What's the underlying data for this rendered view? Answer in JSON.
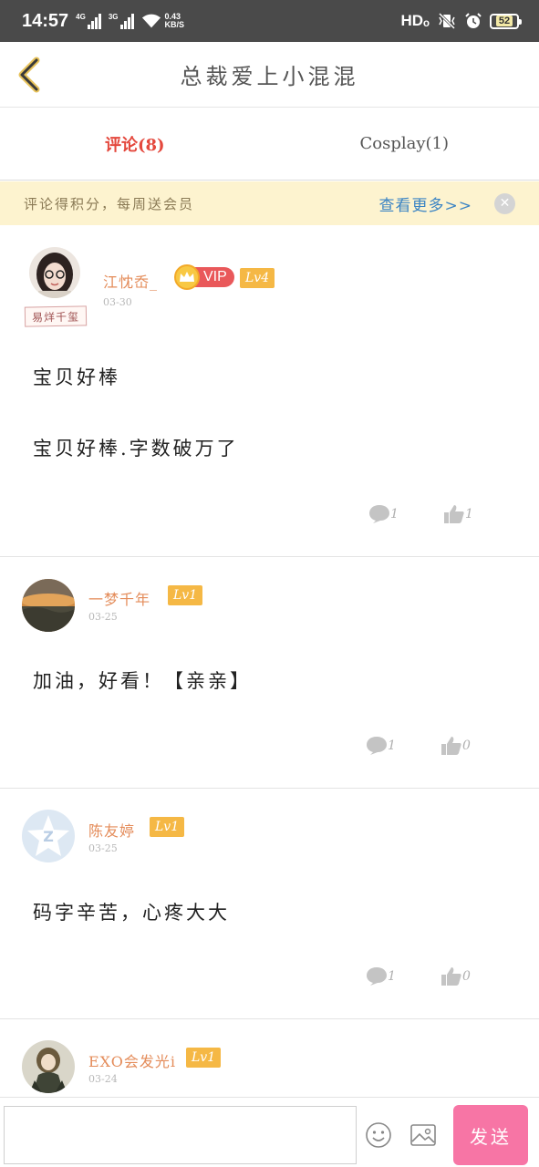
{
  "status_bar": {
    "time": "14:57",
    "net1": "4G",
    "net2": "3G",
    "speed_value": "0.43",
    "speed_unit": "KB/S",
    "hd": "HDₒ",
    "battery": "52"
  },
  "header": {
    "title": "总裁爱上小混混",
    "back_icon": "chevron-left-icon"
  },
  "tabs": [
    {
      "label": "评论(8)",
      "active": true
    },
    {
      "label": "Cosplay(1)",
      "active": false
    }
  ],
  "notice": {
    "message": "评论得积分，每周送会员",
    "more": "查看更多>>",
    "close": "✕"
  },
  "comments": [
    {
      "username": "江忱岙_",
      "vip": "VIP",
      "level": "Lv4",
      "date": "03-30",
      "pendant": "易烊千玺",
      "lines": [
        "宝贝好棒",
        "宝贝好棒.字数破万了"
      ],
      "reply_count": "1",
      "like_count": "1"
    },
    {
      "username": "一梦千年",
      "level": "Lv1",
      "date": "03-25",
      "lines": [
        "加油，好看！【亲亲】"
      ],
      "reply_count": "1",
      "like_count": "0"
    },
    {
      "username": "陈友婷",
      "level": "Lv1",
      "date": "03-25",
      "lines": [
        "码字辛苦，心疼大大"
      ],
      "reply_count": "1",
      "like_count": "0"
    },
    {
      "username": "EXO会发光i",
      "level": "Lv1",
      "date": "03-24"
    }
  ],
  "input_bar": {
    "value": "",
    "send_label": "发送"
  },
  "colors": {
    "accent_red": "#e4483d",
    "username_orange": "#e48c5a",
    "level_badge": "#f5b845",
    "notice_bg": "#fdf3cf",
    "link_blue": "#3b84c4",
    "send_pink": "#f775a5"
  }
}
